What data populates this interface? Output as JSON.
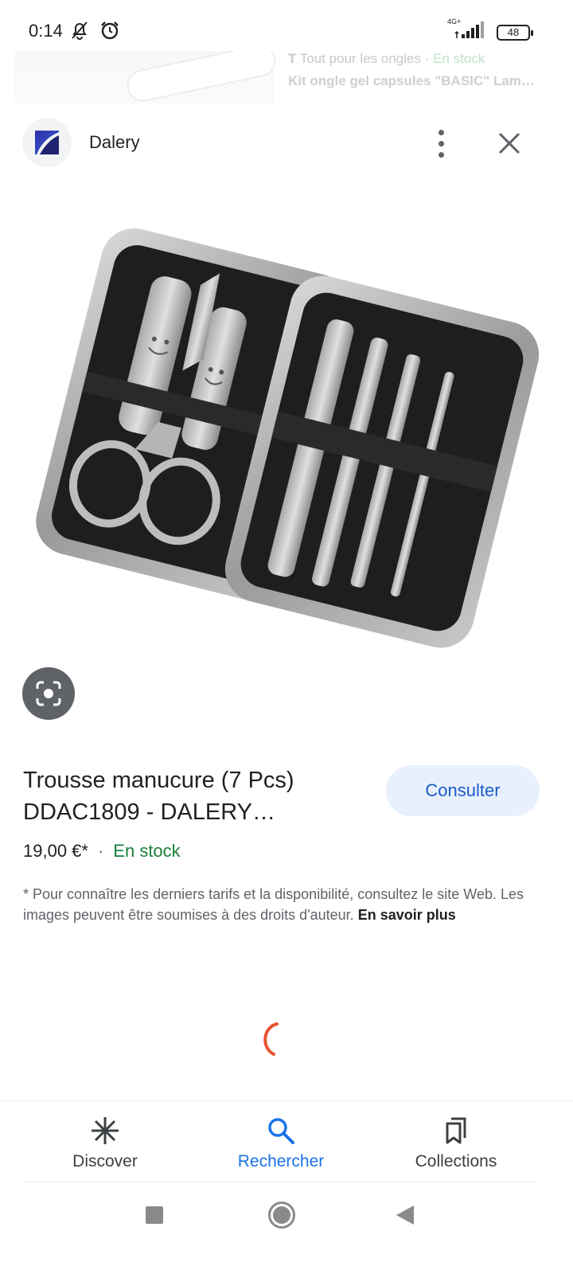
{
  "status": {
    "time": "0:14",
    "network": "4G+",
    "battery": "48"
  },
  "peek": {
    "source_icon": "T",
    "source": "Tout pour les ongles",
    "source_sep": " · ",
    "stock": "En stock",
    "title": "Kit ongle gel capsules \"BASIC\" Lam…"
  },
  "header": {
    "site_name": "Dalery"
  },
  "product": {
    "title": "Trousse manucure (7 Pcs) DDAC1809 - DALERY…",
    "consult_label": "Consulter",
    "price": "19,00 €*",
    "separator": "·",
    "stock": "En stock",
    "disclaimer": "* Pour connaître les derniers tarifs et la disponibilité, consultez le site Web. Les images peuvent être soumises à des droits d'auteur.",
    "learn_more": "En savoir plus"
  },
  "bottom_nav": [
    {
      "label": "Discover",
      "icon": "asterisk-icon"
    },
    {
      "label": "Rechercher",
      "icon": "search-icon",
      "active": true
    },
    {
      "label": "Collections",
      "icon": "collections-icon"
    }
  ],
  "colors": {
    "accent": "#1a73e8",
    "stock_green": "#188038",
    "consult_bg": "#e8f0fe",
    "spinner": "#e8532f"
  }
}
